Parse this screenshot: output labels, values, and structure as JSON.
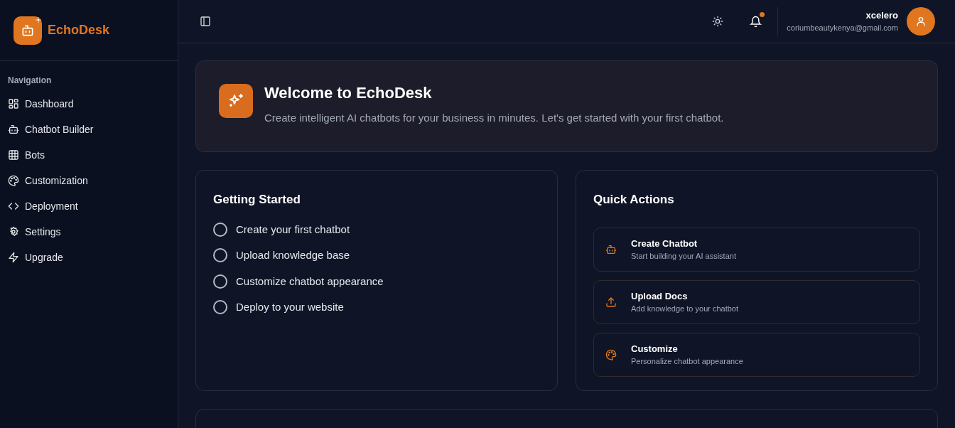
{
  "sidebar": {
    "brand": "EchoDesk",
    "section_label": "Navigation",
    "items": [
      {
        "label": "Dashboard"
      },
      {
        "label": "Chatbot Builder"
      },
      {
        "label": "Bots"
      },
      {
        "label": "Customization"
      },
      {
        "label": "Deployment"
      },
      {
        "label": "Settings"
      },
      {
        "label": "Upgrade"
      }
    ]
  },
  "header": {
    "notification_unread": true,
    "user": {
      "name": "xcelero",
      "email": "coriumbeautykenya@gmail.com"
    }
  },
  "welcome": {
    "title": "Welcome to EchoDesk",
    "subtitle": "Create intelligent AI chatbots for your business in minutes. Let's get started with your first chatbot."
  },
  "getting_started": {
    "title": "Getting Started",
    "steps": [
      {
        "label": "Create your first chatbot",
        "checked": false
      },
      {
        "label": "Upload knowledge base",
        "checked": false
      },
      {
        "label": "Customize chatbot appearance",
        "checked": false
      },
      {
        "label": "Deploy to your website",
        "checked": false
      }
    ]
  },
  "quick_actions": {
    "title": "Quick Actions",
    "actions": [
      {
        "title": "Create Chatbot",
        "description": "Start building your AI assistant"
      },
      {
        "title": "Upload Docs",
        "description": "Add knowledge to your chatbot"
      },
      {
        "title": "Customize",
        "description": "Personalize chatbot appearance"
      }
    ]
  }
}
